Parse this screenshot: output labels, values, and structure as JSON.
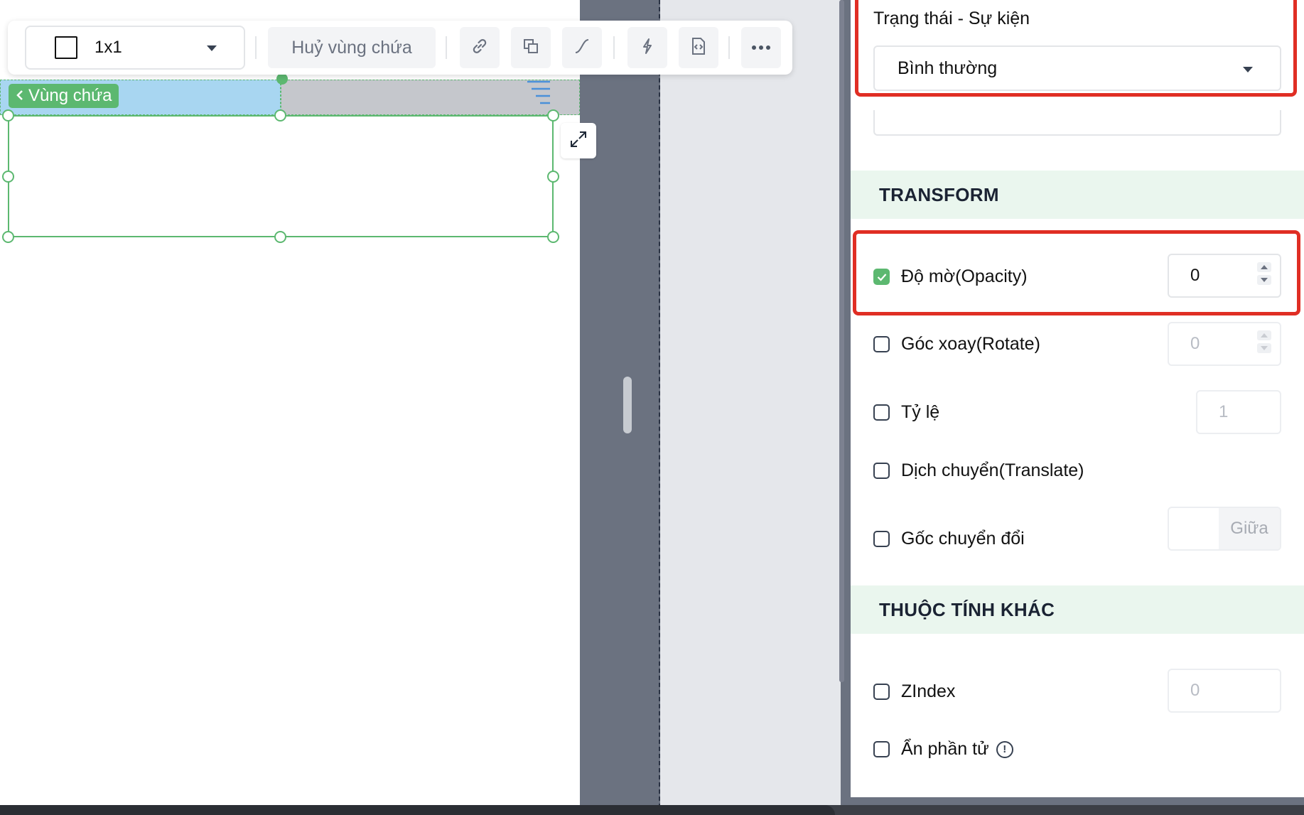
{
  "toolbar": {
    "size_value": "1x1",
    "cancel_container_label": "Huỷ vùng chứa",
    "icons": [
      "link-icon",
      "duplicate-icon",
      "curve-icon",
      "lightning-icon",
      "code-file-icon",
      "more-icon"
    ]
  },
  "canvas": {
    "container_tag": "Vùng chứa"
  },
  "panel": {
    "state_event_label": "Trạng thái - Sự kiện",
    "state_event_value": "Bình thường",
    "transform_heading": "TRANSFORM",
    "opacity": {
      "label": "Độ mờ(Opacity)",
      "checked": true,
      "value": "0"
    },
    "rotate": {
      "label": "Góc xoay(Rotate)",
      "checked": false,
      "value": "0"
    },
    "scale": {
      "label": "Tỷ lệ",
      "checked": false,
      "value": "1"
    },
    "translate": {
      "label": "Dịch chuyển(Translate)",
      "checked": false
    },
    "origin": {
      "label": "Gốc chuyển đổi",
      "checked": false,
      "suffix": "Giữa"
    },
    "other_heading": "THUỘC TÍNH KHÁC",
    "zindex": {
      "label": "ZIndex",
      "checked": false,
      "value": "0"
    },
    "hide": {
      "label": "Ẩn phần tử",
      "checked": false
    }
  },
  "colors": {
    "accent_green": "#5cb870",
    "highlight_red": "#e02e24",
    "section_bg": "#eaf6ee",
    "container_blue": "#a8d6f1"
  }
}
